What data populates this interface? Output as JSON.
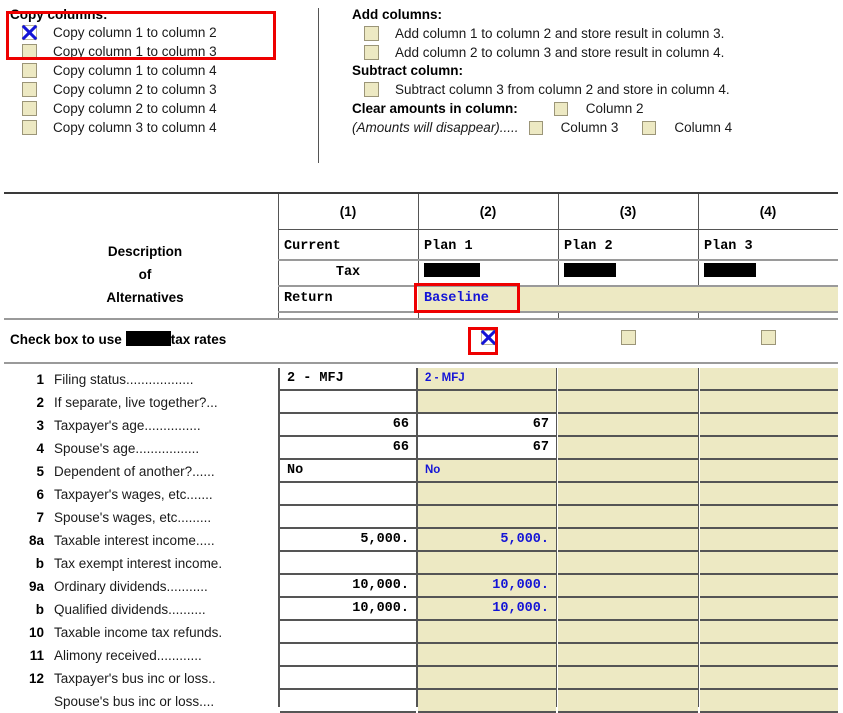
{
  "copy_panel": {
    "title": "Copy columns:",
    "options": [
      {
        "label": "Copy column 1 to column 2",
        "checked": true,
        "icon": "checkbox-checked-icon"
      },
      {
        "label": "Copy column 1 to column 3",
        "checked": false,
        "icon": "checkbox-icon"
      },
      {
        "label": "Copy column 1 to column 4",
        "checked": false,
        "icon": "checkbox-icon"
      },
      {
        "label": "Copy column 2 to column 3",
        "checked": false,
        "icon": "checkbox-icon"
      },
      {
        "label": "Copy column 2 to column 4",
        "checked": false,
        "icon": "checkbox-icon"
      },
      {
        "label": "Copy column 3 to column 4",
        "checked": false,
        "icon": "checkbox-icon"
      }
    ],
    "highlight_color": "#ee0000"
  },
  "ops_panel": {
    "add_title": "Add columns:",
    "add_options": [
      {
        "label": "Add column 1 to column 2 and store result in column 3.",
        "checked": false
      },
      {
        "label": "Add column 2 to column 3 and store result in column 4.",
        "checked": false
      }
    ],
    "subtract_title": "Subtract column:",
    "subtract_options": [
      {
        "label": "Subtract column 3 from column 2 and store in column 4.",
        "checked": false
      }
    ],
    "clear_title": "Clear amounts in column:",
    "clear_note": "(Amounts will disappear).....",
    "clear_options": [
      {
        "label": "Column 2",
        "checked": false
      },
      {
        "label": "Column 3",
        "checked": false
      },
      {
        "label": "Column 4",
        "checked": false
      }
    ]
  },
  "table": {
    "description_header": [
      "Description",
      "of",
      "Alternatives"
    ],
    "column_numbers": [
      "(1)",
      "(2)",
      "(3)",
      "(4)"
    ],
    "columns": [
      {
        "line1": "Current",
        "line2": "Tax",
        "line3": "Return",
        "redacted": false,
        "highlighted": false
      },
      {
        "line1": "Plan 1",
        "line2": "",
        "line3": "Baseline",
        "redacted": true,
        "highlighted": true
      },
      {
        "line1": "Plan 2",
        "line2": "",
        "line3": "",
        "redacted": true,
        "highlighted": false
      },
      {
        "line1": "Plan 3",
        "line2": "",
        "line3": "",
        "redacted": true,
        "highlighted": false
      }
    ],
    "use_rates_label_pre": "Check box to use",
    "use_rates_label_post": "tax rates",
    "use_rates_checks": [
      {
        "present": false,
        "checked": false
      },
      {
        "present": true,
        "checked": true
      },
      {
        "present": true,
        "checked": false
      },
      {
        "present": true,
        "checked": false
      }
    ],
    "rows": [
      {
        "num": "1",
        "desc": "Filing status..................",
        "c1": "2 - MFJ",
        "c1_align": "left",
        "c2": "2 - MFJ",
        "c2_align": "left",
        "c2_style": "small",
        "c2_bg": "beige",
        "c3": "",
        "c4": ""
      },
      {
        "num": "2",
        "desc": "If separate, live together?...",
        "c1": "",
        "c1_align": "right",
        "c2": "",
        "c2_align": "right",
        "c2_style": "",
        "c2_bg": "beige",
        "c3": "",
        "c4": ""
      },
      {
        "num": "3",
        "desc": "Taxpayer's age...............",
        "c1": "66",
        "c1_align": "right",
        "c2": "67",
        "c2_align": "right",
        "c2_style": "black",
        "c2_bg": "white",
        "c3": "",
        "c4": ""
      },
      {
        "num": "4",
        "desc": "Spouse's age.................",
        "c1": "66",
        "c1_align": "right",
        "c2": "67",
        "c2_align": "right",
        "c2_style": "black",
        "c2_bg": "white",
        "c3": "",
        "c4": ""
      },
      {
        "num": "5",
        "desc": "Dependent of another?......",
        "c1": "No",
        "c1_align": "left",
        "c2": "No",
        "c2_align": "left",
        "c2_style": "small",
        "c2_bg": "beige",
        "c3": "",
        "c4": ""
      },
      {
        "num": "6",
        "desc": "Taxpayer's wages, etc.......",
        "c1": "",
        "c1_align": "right",
        "c2": "",
        "c2_align": "right",
        "c2_style": "",
        "c2_bg": "beige",
        "c3": "",
        "c4": ""
      },
      {
        "num": "7",
        "desc": "Spouse's wages, etc.........",
        "c1": "",
        "c1_align": "right",
        "c2": "",
        "c2_align": "right",
        "c2_style": "",
        "c2_bg": "beige",
        "c3": "",
        "c4": ""
      },
      {
        "num": "8a",
        "desc": "Taxable interest income.....",
        "c1": "5,000.",
        "c1_align": "right",
        "c2": "5,000.",
        "c2_align": "right",
        "c2_style": "mono",
        "c2_bg": "beige",
        "c3": "",
        "c4": ""
      },
      {
        "num": "b",
        "desc": "Tax exempt interest income.",
        "c1": "",
        "c1_align": "right",
        "c2": "",
        "c2_align": "right",
        "c2_style": "",
        "c2_bg": "beige",
        "c3": "",
        "c4": ""
      },
      {
        "num": "9a",
        "desc": "Ordinary dividends...........",
        "c1": "10,000.",
        "c1_align": "right",
        "c2": "10,000.",
        "c2_align": "right",
        "c2_style": "mono",
        "c2_bg": "beige",
        "c3": "",
        "c4": ""
      },
      {
        "num": "b",
        "desc": "Qualified dividends..........",
        "c1": "10,000.",
        "c1_align": "right",
        "c2": "10,000.",
        "c2_align": "right",
        "c2_style": "mono",
        "c2_bg": "beige",
        "c3": "",
        "c4": ""
      },
      {
        "num": "10",
        "desc": "Taxable income tax refunds.",
        "c1": "",
        "c1_align": "right",
        "c2": "",
        "c2_align": "right",
        "c2_style": "",
        "c2_bg": "beige",
        "c3": "",
        "c4": ""
      },
      {
        "num": "11",
        "desc": "Alimony received............",
        "c1": "",
        "c1_align": "right",
        "c2": "",
        "c2_align": "right",
        "c2_style": "",
        "c2_bg": "beige",
        "c3": "",
        "c4": ""
      },
      {
        "num": "12",
        "desc": "Taxpayer's bus inc or loss..",
        "c1": "",
        "c1_align": "right",
        "c2": "",
        "c2_align": "right",
        "c2_style": "",
        "c2_bg": "beige",
        "c3": "",
        "c4": ""
      },
      {
        "num": "",
        "desc": "Spouse's bus inc or loss....",
        "c1": "",
        "c1_align": "right",
        "c2": "",
        "c2_align": "right",
        "c2_style": "",
        "c2_bg": "beige",
        "c3": "",
        "c4": ""
      }
    ]
  },
  "colors": {
    "field_beige": "#EDE9C3",
    "accent_blue": "#1414d6",
    "highlight_red": "#ee0000",
    "redaction_black": "#000000"
  }
}
